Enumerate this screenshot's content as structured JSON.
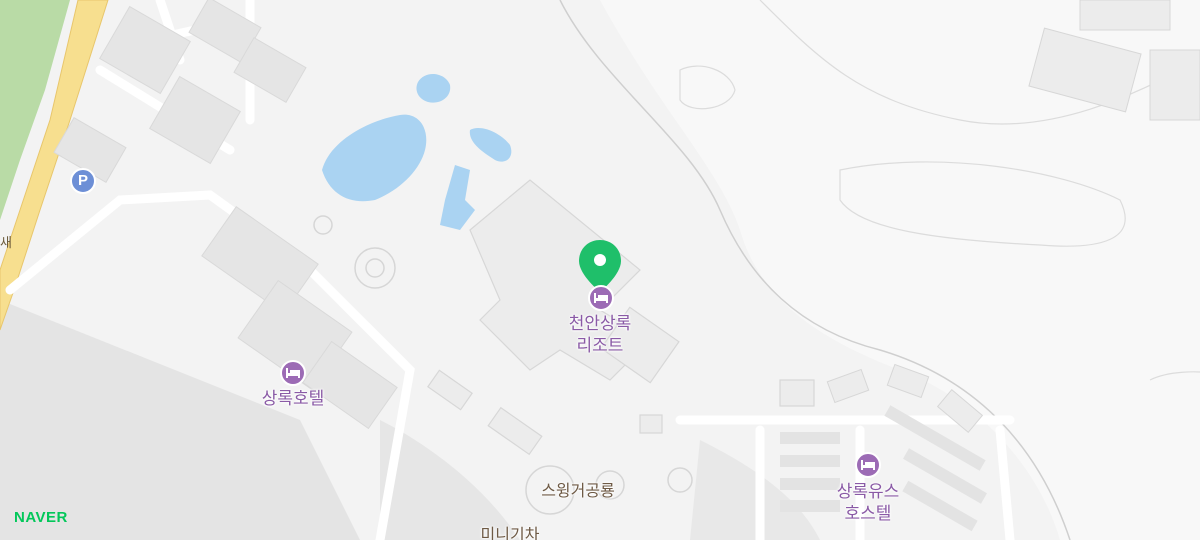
{
  "brand": "NAVER",
  "road_label": "새",
  "colors": {
    "pin": "#1fbf6a",
    "poi": "#9c6bb5",
    "poi_text": "#8a5aa6",
    "water": "#aad3f2",
    "park": "#b9dba6",
    "road_main": "#f7df8f",
    "parking": "#6d8fd6"
  },
  "parking": {
    "icon": "parking-icon",
    "glyph": "P"
  },
  "selected": {
    "name_line1": "천안상록",
    "name_line2": "리조트",
    "icon": "hotel-icon"
  },
  "places": [
    {
      "line1": "상록호텔",
      "line2": "",
      "icon": "hotel-icon"
    },
    {
      "line1": "상록유스",
      "line2": "호스텔",
      "icon": "hotel-icon"
    }
  ],
  "landmarks": [
    {
      "text": "스윙거공룡"
    },
    {
      "text": "미니기차"
    }
  ]
}
